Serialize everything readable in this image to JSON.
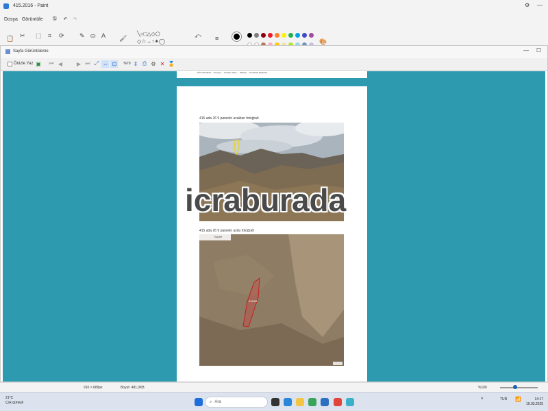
{
  "window": {
    "title": "415.2016 - Paint",
    "controls": [
      "⚙",
      "—",
      "☐"
    ]
  },
  "menu": [
    "Dosya",
    "Görüntüle"
  ],
  "palette": {
    "selected": "#000000",
    "row1": [
      "#000000",
      "#7f7f7f",
      "#880015",
      "#ed1c24",
      "#ff7f27",
      "#fff200",
      "#22b14c",
      "#00a2e8",
      "#3f48cc",
      "#a349a4"
    ],
    "row2": [
      "#ffffff",
      "#c3c3c3",
      "#b97a57",
      "#ffaec9",
      "#ffc90e",
      "#efe4b0",
      "#b5e61d",
      "#99d9ea",
      "#7092be",
      "#c8bfe7"
    ]
  },
  "viewer": {
    "title": "Sayfa Görüntüleme",
    "print_label": "Önizle Yaz",
    "zoom": "%70",
    "controls": [
      "—",
      "☐",
      "✕"
    ]
  },
  "document": {
    "top_caption": "HÜS 415.2016 ... Amasya ... Yerleşim Alanı ... Haritası ... Koordinat Değerleri",
    "caption1": "415 ada 26 9 parselin uzaktan fotoğrafı",
    "caption2": "415 ada 26 9 parselin uydu fotoğrafı",
    "parcel_label": "415/26",
    "map_toolbar": "Kaydet"
  },
  "watermark": "icraburada",
  "status": {
    "dimensions": "910 × 689px",
    "size": "Boyut: 481,0KB",
    "zoom": "%100"
  },
  "taskbar": {
    "weather_temp": "21°C",
    "weather_desc": "Çok güneşli",
    "search_placeholder": "Ara",
    "lang": "TUR",
    "time": "14:17",
    "date": "10.03.2025"
  }
}
